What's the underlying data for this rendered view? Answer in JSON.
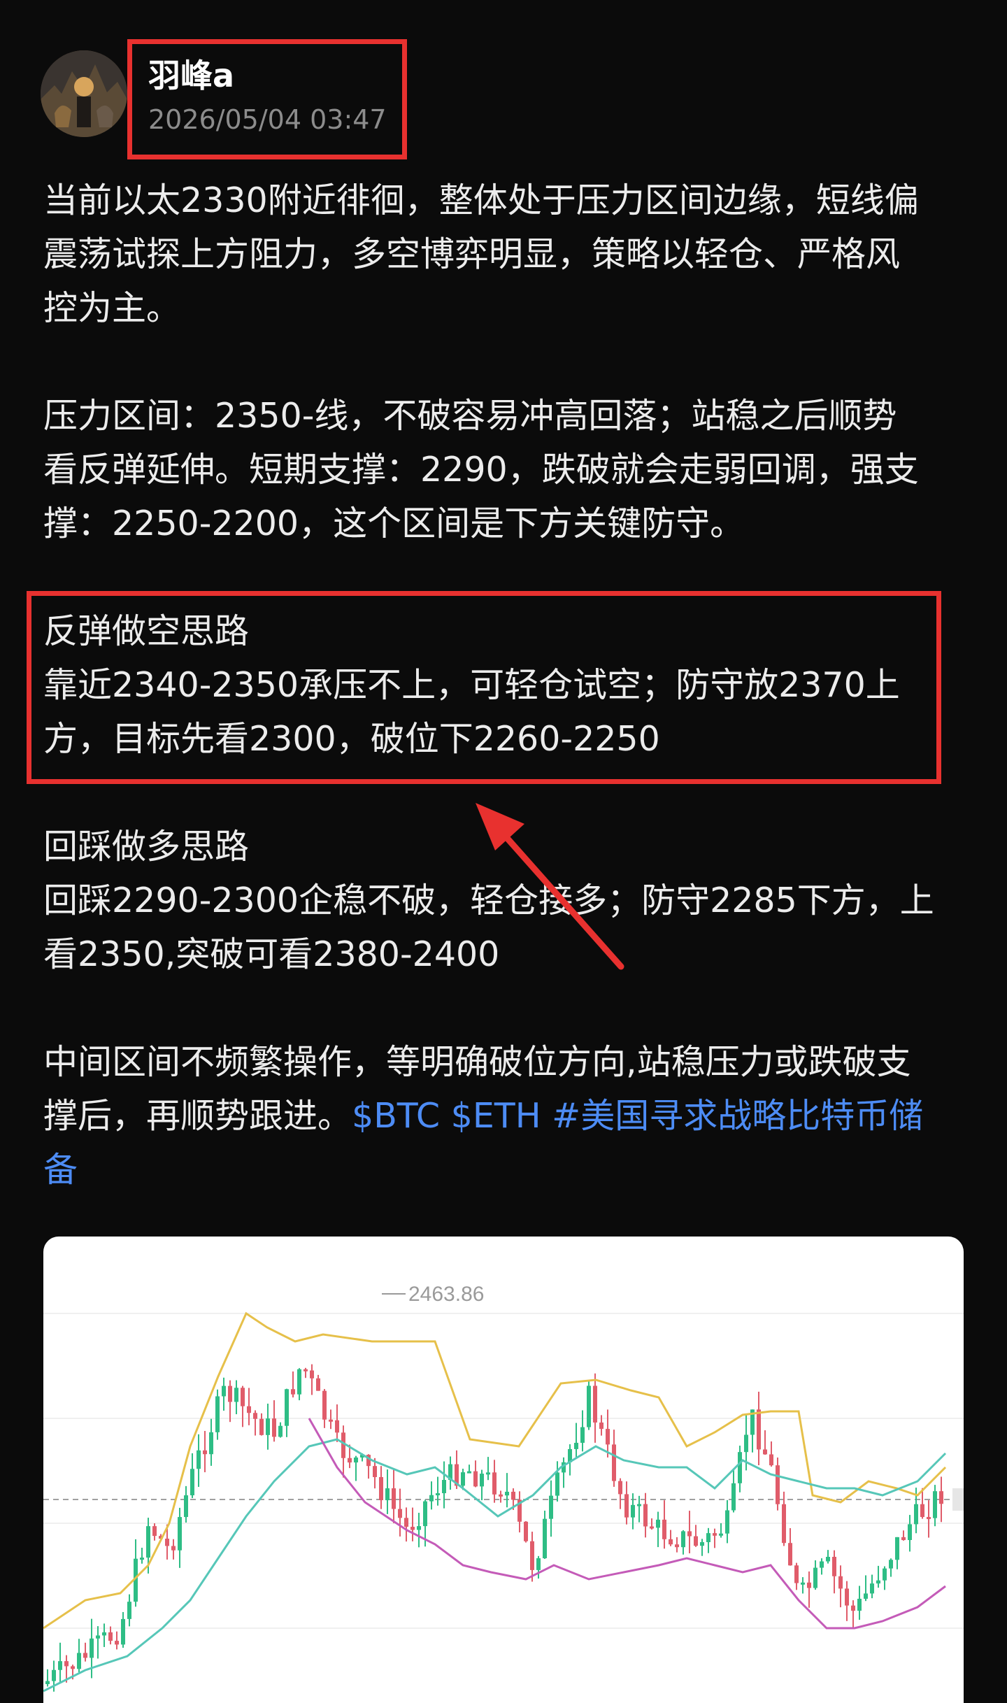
{
  "post": {
    "author": "羽峰a",
    "timestamp": "2026/05/04 03:47",
    "paragraphs": [
      "当前以太2330附近徘徊，整体处于压力区间边缘，短线偏\n震荡试探上方阻力，多空博弈明显，策略以轻仓、严格风\n控为主。",
      "压力区间：2350-线，不破容易冲高回落；站稳之后顺势\n看反弹延伸。短期支撑：2290，跌破就会走弱回调，强支\n撑：2250-2200，这个区间是下方关键防守。",
      "反弹做空思路\n靠近2340-2350承压不上，可轻仓试空；防守放2370上\n方，目标先看2300，破位下2260-2250",
      "回踩做多思路\n回踩2290-2300企稳不破，轻仓接多；防守2285下方，上\n看2350,突破可看2380-2400"
    ],
    "last_paragraph_text": "中间区间不频繁操作，等明确破位方向,站稳压力或跌破支\n撑后，再顺势跟进。",
    "tags": [
      "$BTC",
      "$ETH",
      "#美国寻求战略比特币储\n备"
    ]
  },
  "chart": {
    "high_label": "2463.86",
    "colors": {
      "up": "#2ebd85",
      "down": "#e05c6a",
      "upper_band": "#e6c04a",
      "middle_band": "#56c7b8",
      "lower_band": "#c45bb8",
      "highlight_box": "#e8312f",
      "link": "#4d8cf5"
    }
  }
}
